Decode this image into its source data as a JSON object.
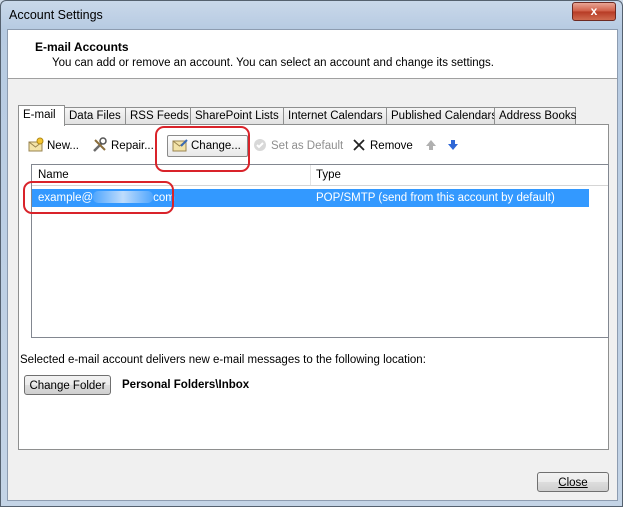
{
  "window": {
    "title": "Account Settings",
    "close_glyph": "x"
  },
  "header": {
    "title": "E-mail Accounts",
    "description": "You can add or remove an account. You can select an account and change its settings."
  },
  "tabs": [
    {
      "label": "E-mail",
      "active": true
    },
    {
      "label": "Data Files",
      "active": false
    },
    {
      "label": "RSS Feeds",
      "active": false
    },
    {
      "label": "SharePoint Lists",
      "active": false
    },
    {
      "label": "Internet Calendars",
      "active": false
    },
    {
      "label": "Published Calendars",
      "active": false
    },
    {
      "label": "Address Books",
      "active": false
    }
  ],
  "toolbar": {
    "new": {
      "label": "New...",
      "icon": "new-account-icon"
    },
    "repair": {
      "label": "Repair...",
      "icon": "tools-icon"
    },
    "change": {
      "label": "Change...",
      "icon": "change-account-icon"
    },
    "set_default": {
      "label": "Set as Default",
      "icon": "checkmark-icon",
      "enabled": false
    },
    "remove": {
      "label": "Remove",
      "icon": "x-icon"
    },
    "move_up_icon": "arrow-up-icon",
    "move_down_icon": "arrow-down-icon"
  },
  "accounts_list": {
    "columns": [
      "Name",
      "Type"
    ],
    "rows": [
      {
        "name_prefix": "example@",
        "name_suffix": "com",
        "type": "POP/SMTP (send from this account by default)",
        "selected": true
      }
    ]
  },
  "delivery": {
    "label": "Selected e-mail account delivers new e-mail messages to the following location:",
    "change_folder_label": "Change Folder",
    "folder_path": "Personal Folders\\Inbox"
  },
  "footer": {
    "close_label": "Close"
  },
  "colors": {
    "selection": "#3399ff",
    "highlight_box": "#d9232a"
  }
}
